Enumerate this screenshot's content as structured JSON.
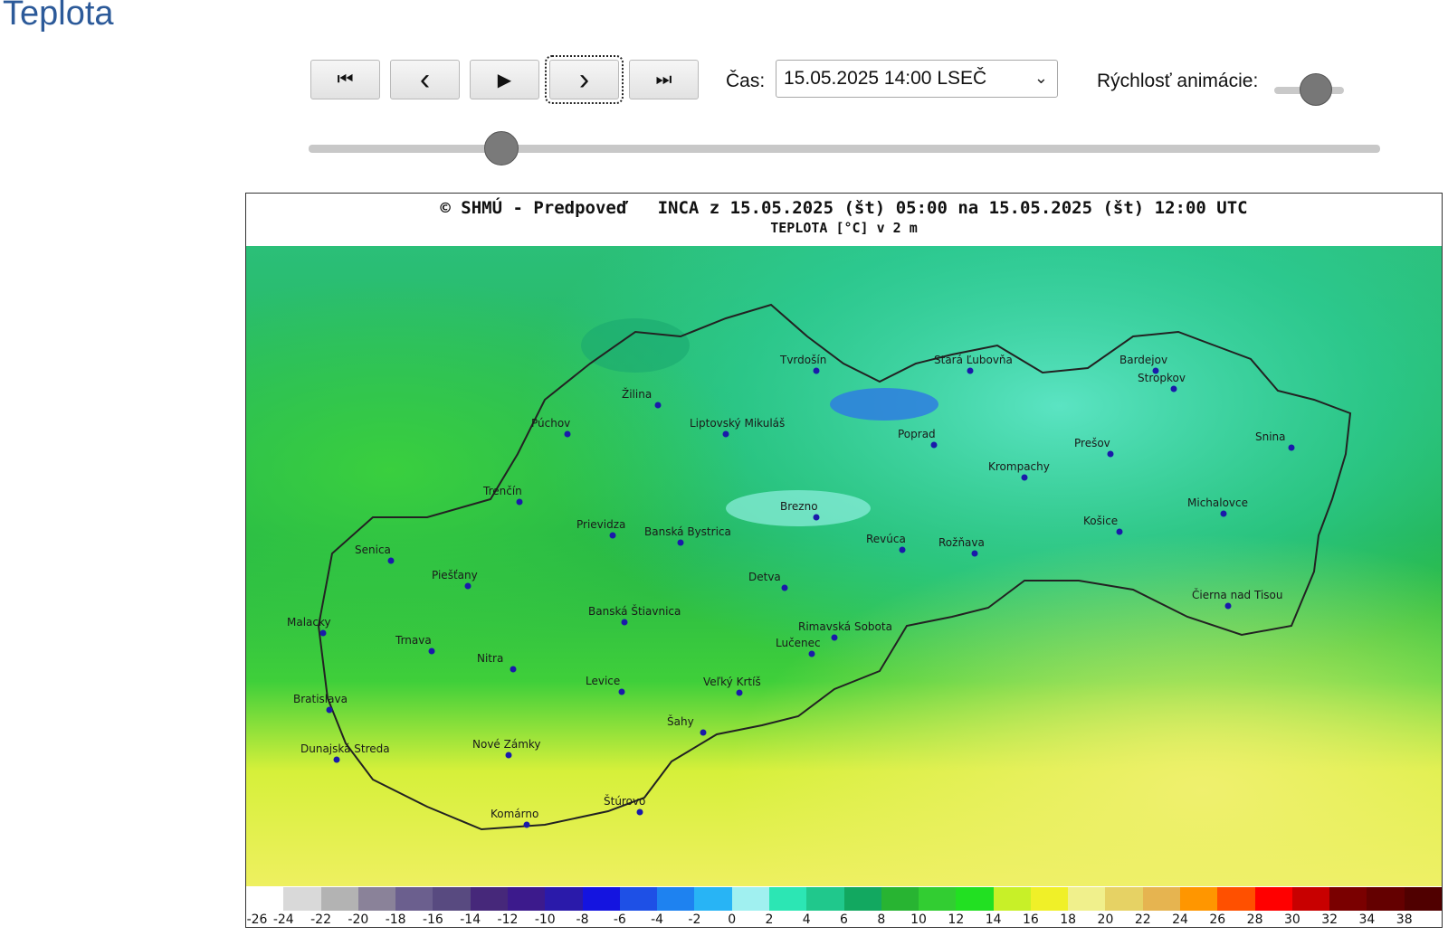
{
  "page_title": "Teplota",
  "controls": {
    "buttons": [
      {
        "name": "first-frame-button",
        "icon": "skip-to-start-icon",
        "glyph": "⏮"
      },
      {
        "name": "prev-frame-button",
        "icon": "chevron-left-icon",
        "glyph": "‹"
      },
      {
        "name": "play-button",
        "icon": "play-icon",
        "glyph": "▶"
      },
      {
        "name": "next-frame-button",
        "icon": "chevron-right-icon",
        "glyph": "›"
      },
      {
        "name": "last-frame-button",
        "icon": "skip-to-end-icon",
        "glyph": "⏭"
      }
    ],
    "time_label": "Čas:",
    "time_value": "15.05.2025 14:00 LSEČ",
    "speed_label": "Rýchlosť animácie:",
    "speed_level": 0.6,
    "time_slider_position": 0.18
  },
  "map": {
    "title": "© SHMÚ - Predpoveď   INCA z 15.05.2025 (št) 05:00 na 15.05.2025 (št) 12:00 UTC",
    "subtitle": "TEPLOTA [°C] v 2 m",
    "cities": [
      "Tvrdošín",
      "Stará Ľubovňa",
      "Bardejov",
      "Stropkov",
      "Žilina",
      "Púchov",
      "Liptovský Mikuláš",
      "Poprad",
      "Prešov",
      "Snina",
      "Krompachy",
      "Trenčín",
      "Brezno",
      "Michalovce",
      "Prievidza",
      "Banská Bystrica",
      "Revúca",
      "Rožňava",
      "Košice",
      "Senica",
      "Piešťany",
      "Detva",
      "Čierna nad Tisou",
      "Malacky",
      "Banská Štiavnica",
      "Rimavská Sobota",
      "Trnava",
      "Lučenec",
      "Nitra",
      "Levice",
      "Veľký Krtíš",
      "Bratislava",
      "Šahy",
      "Nové Zámky",
      "Dunajská Streda",
      "Štúrovo",
      "Komárno"
    ],
    "legend": {
      "colors": [
        "#ffffff",
        "#d9d9d9",
        "#b3b3b3",
        "#8a8299",
        "#6b5f8e",
        "#584a80",
        "#46287a",
        "#3c1a8c",
        "#2a1aaa",
        "#1414e0",
        "#1e50e6",
        "#1e82f0",
        "#28b4f5",
        "#a0f0f0",
        "#2ce6b4",
        "#20c88c",
        "#12a860",
        "#28b432",
        "#32cd32",
        "#22e022",
        "#c8f028",
        "#f0f028",
        "#f0f08c",
        "#e6d264",
        "#e6b450",
        "#ff9600",
        "#ff5000",
        "#ff0000",
        "#c80000",
        "#7a0000",
        "#640000",
        "#500000"
      ],
      "labels": [
        "-26",
        "-24",
        "-22",
        "-20",
        "-18",
        "-16",
        "-14",
        "-12",
        "-10",
        "-8",
        "-6",
        "-4",
        "-2",
        "0",
        "2",
        "4",
        "6",
        "8",
        "10",
        "12",
        "14",
        "16",
        "18",
        "20",
        "22",
        "24",
        "26",
        "28",
        "30",
        "32",
        "34",
        "38"
      ]
    }
  }
}
